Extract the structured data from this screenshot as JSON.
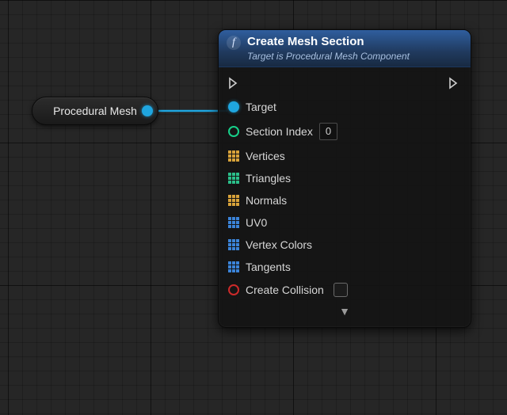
{
  "variable_node": {
    "label": "Procedural Mesh"
  },
  "function_node": {
    "icon_glyph": "f",
    "title": "Create Mesh Section",
    "subtitle": "Target is Procedural Mesh Component",
    "pins": {
      "target": "Target",
      "section_index": {
        "label": "Section Index",
        "value": "0"
      },
      "vertices": "Vertices",
      "triangles": "Triangles",
      "normals": "Normals",
      "uv0": "UV0",
      "vertex_colors": "Vertex Colors",
      "tangents": "Tangents",
      "create_collision": {
        "label": "Create Collision",
        "checked": false
      }
    },
    "expand_glyph": "▼"
  }
}
